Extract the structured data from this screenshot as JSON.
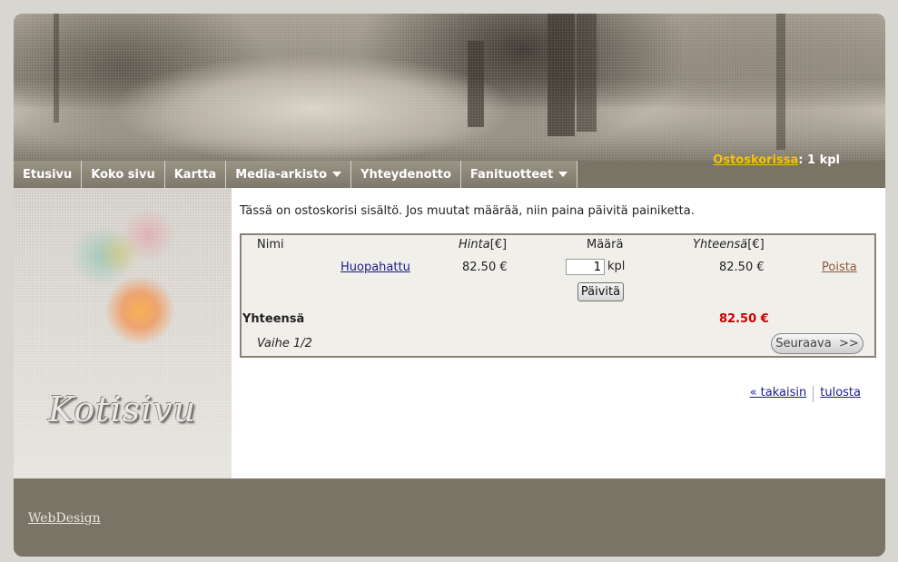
{
  "nav": {
    "items": [
      {
        "label": "Etusivu"
      },
      {
        "label": "Koko sivu"
      },
      {
        "label": "Kartta"
      },
      {
        "label": "Media-arkisto"
      },
      {
        "label": "Yhteydenotto"
      },
      {
        "label": "Fanituotteet"
      }
    ]
  },
  "cart_status": {
    "link": "Ostoskorissa",
    "separator": ":",
    "count": "1 kpl"
  },
  "sidebar": {
    "logo_text": "Kotisivu"
  },
  "content": {
    "intro": "Tässä on ostoskorisi sisältö. Jos muutat määrää, niin paina päivitä painiketta.",
    "table": {
      "col_name": "Nimi",
      "col_price_italic": "Hinta",
      "col_price_unit": "[€]",
      "col_qty": "Määrä",
      "col_total_italic": "Yhteensä",
      "col_total_unit": "[€]"
    },
    "item": {
      "name": "Huopahattu",
      "price": "82.50 €",
      "quantity": "1",
      "unit": "kpl",
      "total": "82.50 €",
      "remove": "Poista"
    },
    "update_button": "Päivitä",
    "sum_label": "Yhteensä",
    "sum_value": "82.50 €",
    "step": "Vaihe 1/2",
    "next_button": "Seuraava  >>",
    "back_link": "« takaisin",
    "print_link": "tulosta"
  },
  "footer": {
    "link": "WebDesign"
  },
  "colors": {
    "nav_bg": "#7a7466",
    "cart_link": "#f5c400",
    "sum_red": "#cc0000",
    "remove_link": "#8b5a3c"
  }
}
